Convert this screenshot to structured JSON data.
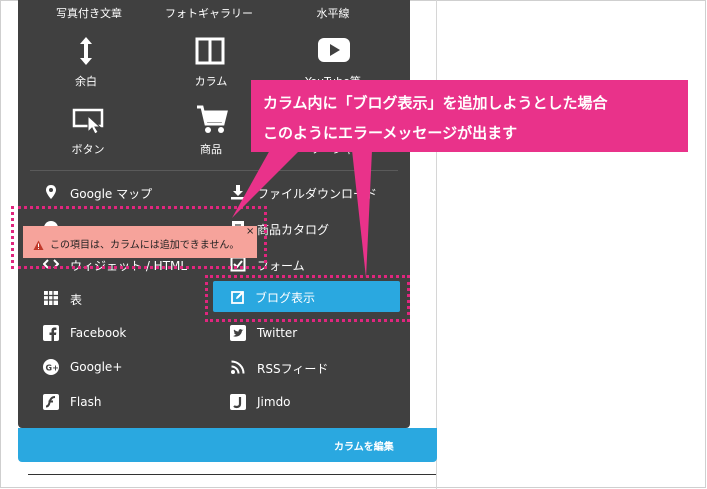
{
  "menu": {
    "top_row": [
      "写真付き文章",
      "フォトギャラリー",
      "水平線"
    ],
    "items": [
      {
        "label": "余白",
        "icon": "vertical-resize-icon"
      },
      {
        "label": "カラム",
        "icon": "columns-icon"
      },
      {
        "label": "YouTube等",
        "icon": "play-icon"
      },
      {
        "label": "ボタン",
        "icon": "button-cursor-icon"
      },
      {
        "label": "商品",
        "icon": "cart-icon"
      },
      {
        "label": "ソーシャル",
        "icon": "share-icon"
      }
    ],
    "list": [
      {
        "label": "Google マップ",
        "icon": "map-pin-icon"
      },
      {
        "label": "ファイルダウンロード",
        "icon": "download-icon"
      },
      {
        "label": "商品カタログ",
        "icon": "catalog-icon"
      },
      {
        "label": "ウィジェット / HTML",
        "icon": "code-icon"
      },
      {
        "label": "フォーム",
        "icon": "form-icon"
      },
      {
        "label": "表",
        "icon": "table-icon"
      },
      {
        "label": "ブログ表示",
        "icon": "edit-icon"
      },
      {
        "label": "Facebook",
        "icon": "facebook-icon"
      },
      {
        "label": "Twitter",
        "icon": "twitter-icon"
      },
      {
        "label": "Google+",
        "icon": "googleplus-icon"
      },
      {
        "label": "RSSフィード",
        "icon": "rss-icon"
      },
      {
        "label": "Flash",
        "icon": "flash-icon"
      },
      {
        "label": "Jimdo",
        "icon": "jimdo-icon"
      }
    ]
  },
  "edit_bar": {
    "label": "カラムを編集"
  },
  "error": {
    "message": "この項目は、カラムには追加できません。",
    "close": "×"
  },
  "callout": {
    "line1": "カラム内に「ブログ表示」を追加しようとした場合",
    "line2": "このようにエラーメッセージが出ます"
  },
  "colors": {
    "menu_bg": "#404040",
    "accent": "#2aa8e0",
    "highlight": "#e0267e",
    "error_bg": "#f6a39b"
  }
}
